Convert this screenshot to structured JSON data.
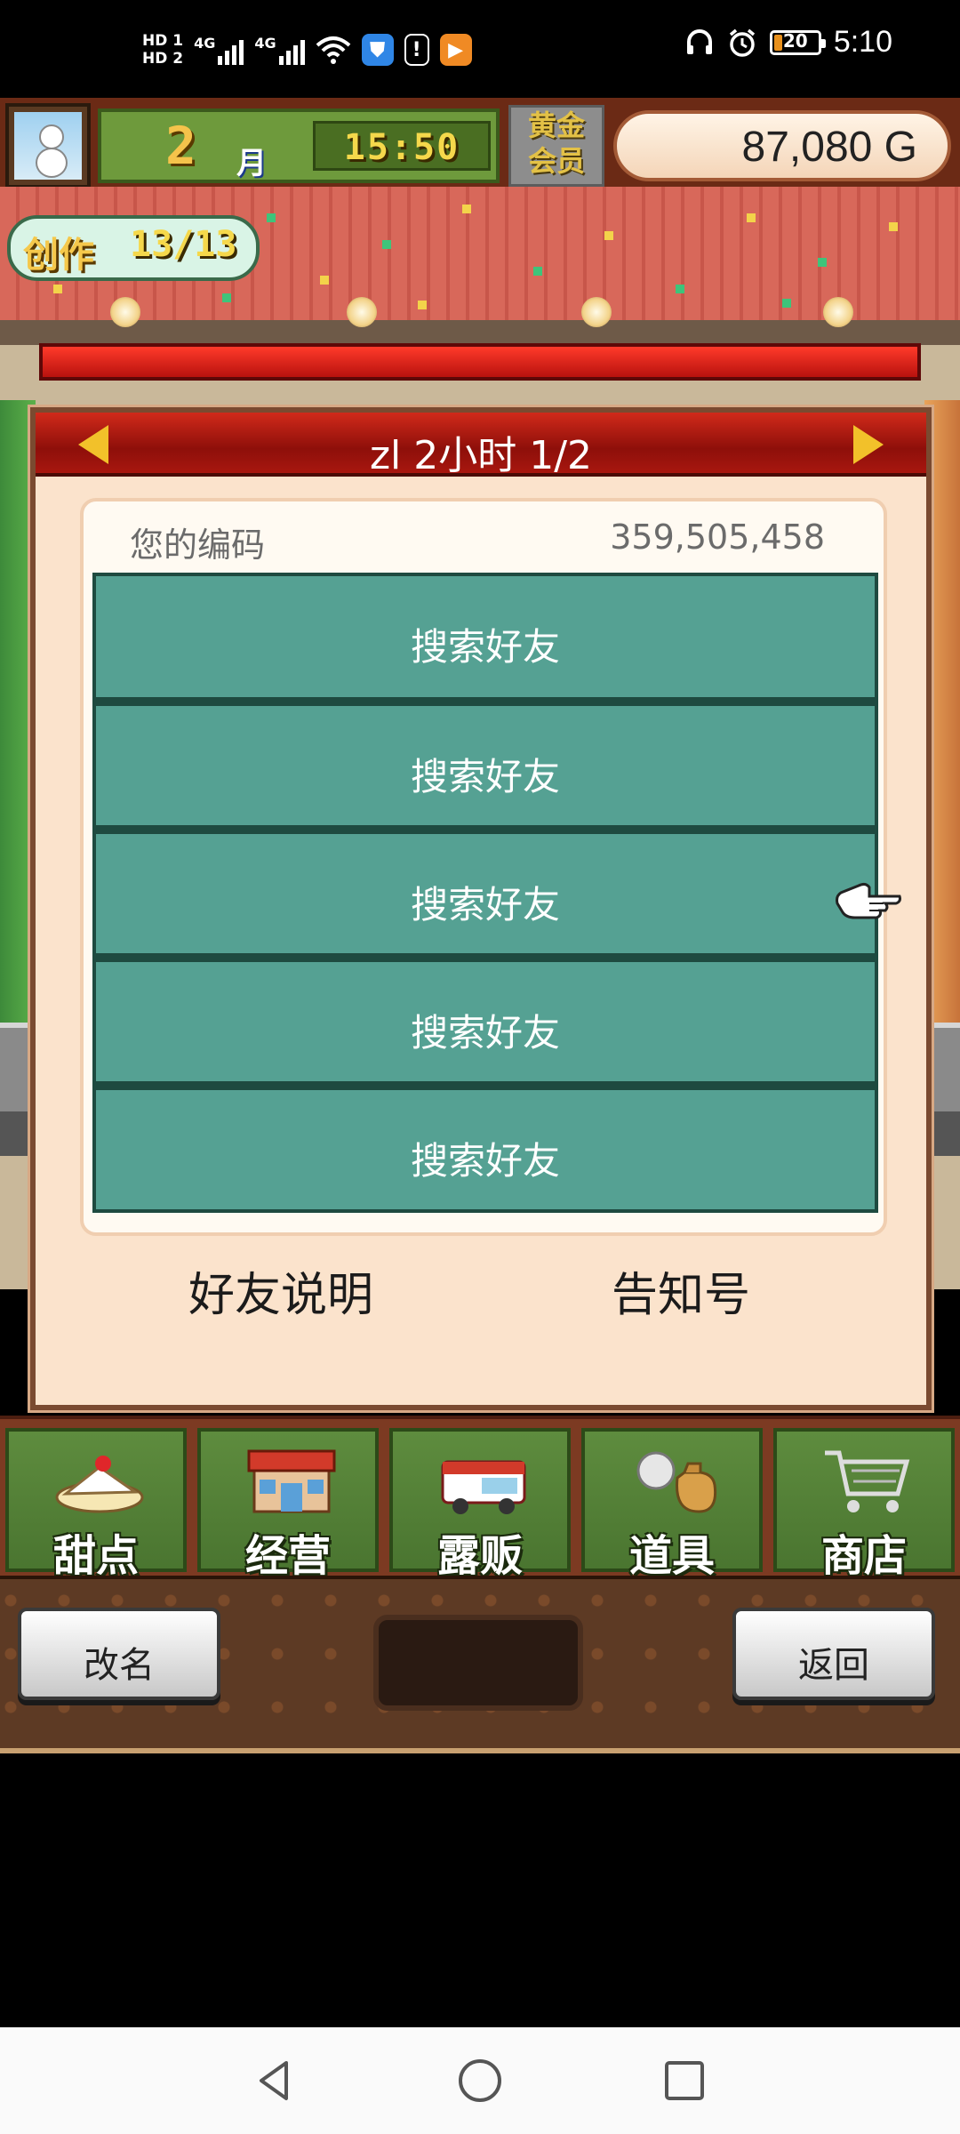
{
  "status_bar": {
    "hd1": "HD 1",
    "hd2": "HD 2",
    "net1": "4G",
    "net2": "4G",
    "time": "5:10",
    "battery_level": "20",
    "battery_percent": 20
  },
  "hud": {
    "month_number": "2",
    "month_label": "月",
    "clock": "15:50",
    "gold_member_line1": "黄金",
    "gold_member_line2": "会员",
    "money": "87,080 G",
    "create_label": "创作",
    "create_count": "13/13"
  },
  "dialog": {
    "title": "zl  2小时 1/2",
    "code_label": "您的编码",
    "code_value": "359,505,458",
    "friend_slots": [
      "搜索好友",
      "搜索好友",
      "搜索好友",
      "搜索好友",
      "搜索好友"
    ],
    "help_link": "好友说明",
    "notice_link": "告知号"
  },
  "menu": {
    "items": [
      {
        "label": "甜点",
        "icon": "cake-icon"
      },
      {
        "label": "经营",
        "icon": "shop-building-icon"
      },
      {
        "label": "露贩",
        "icon": "food-truck-icon"
      },
      {
        "label": "道具",
        "icon": "items-bag-icon"
      },
      {
        "label": "商店",
        "icon": "shopping-cart-icon"
      }
    ]
  },
  "bottom": {
    "rename_label": "改名",
    "back_label": "返回"
  },
  "nav": {
    "back": "back-triangle-icon",
    "home": "home-circle-icon",
    "recents": "recents-square-icon"
  },
  "colors": {
    "slot_teal": "#55a193",
    "header_red": "#b8120e",
    "panel_cream": "#fbe3cc",
    "menu_green": "#4a7530",
    "arrow_yellow": "#f2c12a"
  }
}
